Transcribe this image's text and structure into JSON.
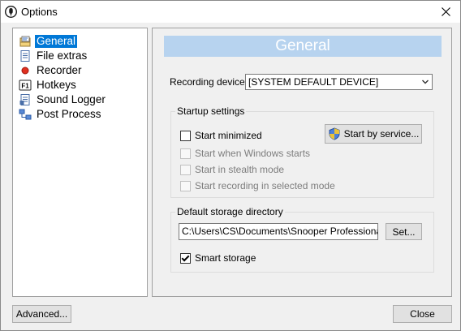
{
  "window": {
    "title": "Options",
    "close_symbol": "✕"
  },
  "tree": {
    "items": [
      {
        "label": "General",
        "icon": "general-icon",
        "selected": true
      },
      {
        "label": "File extras",
        "icon": "file-extras-icon"
      },
      {
        "label": "Recorder",
        "icon": "recorder-icon"
      },
      {
        "label": "Hotkeys",
        "icon": "hotkeys-icon",
        "icon_text": "F1"
      },
      {
        "label": "Sound Logger",
        "icon": "sound-logger-icon"
      },
      {
        "label": "Post Process",
        "icon": "post-process-icon"
      }
    ]
  },
  "panel": {
    "header": "General",
    "recording_device": {
      "label": "Recording device",
      "value": "[SYSTEM DEFAULT DEVICE]"
    },
    "startup": {
      "legend": "Startup settings",
      "start_minimized": {
        "label": "Start minimized",
        "checked": false,
        "enabled": true
      },
      "start_when_windows": {
        "label": "Start when Windows starts",
        "checked": false,
        "enabled": false
      },
      "start_stealth": {
        "label": "Start in stealth mode",
        "checked": false,
        "enabled": false
      },
      "start_recording": {
        "label": "Start recording in selected mode",
        "checked": false,
        "enabled": false
      },
      "service_button": "Start by service..."
    },
    "storage": {
      "legend": "Default storage directory",
      "path": "C:\\Users\\CS\\Documents\\Snooper Professional\\",
      "set_button": "Set...",
      "smart_storage": {
        "label": "Smart storage",
        "checked": true
      }
    }
  },
  "footer": {
    "advanced_button": "Advanced...",
    "close_button": "Close"
  },
  "colors": {
    "selection": "#0078d7",
    "header_bar": "#b7d3ef",
    "recorder_dot": "#e03020"
  }
}
